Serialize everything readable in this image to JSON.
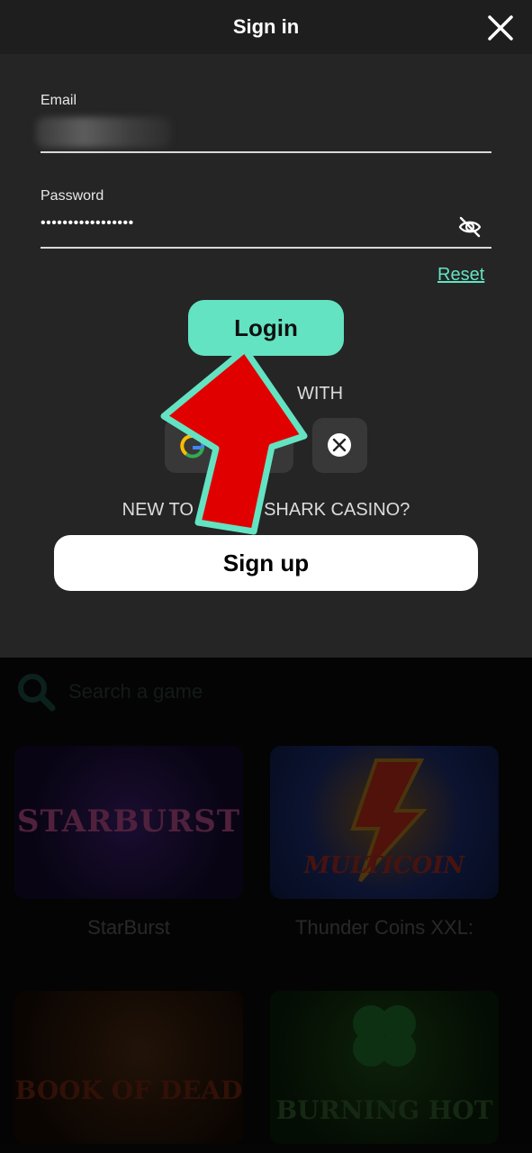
{
  "modal": {
    "title": "Sign in",
    "email_label": "Email",
    "password_label": "Password",
    "password_value": "•••••••••••••••••",
    "reset_label": "Reset",
    "login_label": "Login",
    "or_with_text": "WITH",
    "new_to_text": "NEW TO A      AL SHARK CASINO?",
    "signup_label": "Sign up"
  },
  "background": {
    "search_placeholder": "Search a game",
    "games": [
      {
        "title": "StarBurst",
        "art_text": "STARBURST"
      },
      {
        "title": "Thunder Coins XXL:",
        "art_text": "MULTICOIN"
      },
      {
        "title": "",
        "art_text": "BOOK OF DEAD"
      },
      {
        "title": "",
        "art_text": "BURNING HOT"
      }
    ]
  },
  "colors": {
    "accent": "#63e3c2",
    "modal_bg": "#252525",
    "annotation_arrow": "#e10000"
  },
  "icons": {
    "close": "close-icon",
    "visibility": "eye-off-icon",
    "google": "google-icon",
    "x": "x-logo-icon",
    "search": "search-icon"
  }
}
